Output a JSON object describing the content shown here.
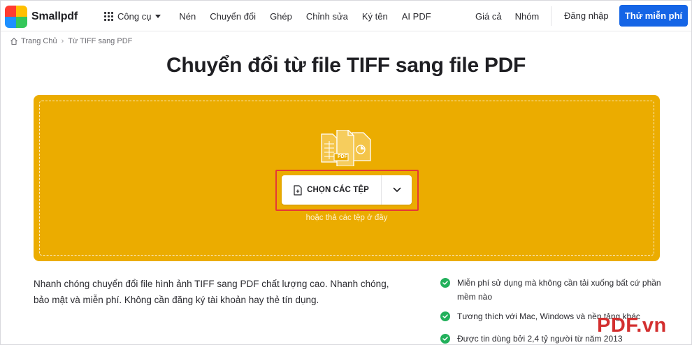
{
  "brand": {
    "name": "Smallpdf",
    "logo_colors": [
      "#ff3b30",
      "#ffbf00",
      "#1e90ff",
      "#34c759"
    ]
  },
  "nav": {
    "tools_label": "Công cụ",
    "links": [
      "Nén",
      "Chuyển đổi",
      "Ghép",
      "Chỉnh sửa",
      "Ký tên",
      "AI PDF"
    ],
    "right_links": [
      "Giá cả",
      "Nhóm"
    ],
    "login_label": "Đăng nhập",
    "cta_label": "Thử miễn phí"
  },
  "breadcrumb": {
    "home": "Trang Chủ",
    "current": "Từ TIFF sang PDF"
  },
  "page": {
    "title": "Chuyển đổi từ file TIFF sang file PDF"
  },
  "upload": {
    "choose_label": "CHỌN CÁC TỆP",
    "drop_hint": "hoặc thả các tệp ở đây",
    "illustration_label": "PDF",
    "accent_color": "#ebac00",
    "highlight_color": "#e53935"
  },
  "description": {
    "line1": "Nhanh chóng chuyển đổi file hình ảnh TIFF sang PDF chất lượng cao. Nhanh chóng,",
    "line2": "bảo mật và miễn phí. Không cần đăng ký tài khoản hay thẻ tín dụng."
  },
  "features": [
    {
      "line1": "Miễn phí sử dụng mà không cần tải xuống bất cứ phần",
      "line2": "mềm nào"
    },
    {
      "line1": "Tương thích với Mac, Windows và nền tảng khác",
      "line2": ""
    },
    {
      "line1": "Được tin dùng bởi 2,4 tỷ người từ năm 2013",
      "line2": ""
    }
  ],
  "watermark": "PDF.vn"
}
